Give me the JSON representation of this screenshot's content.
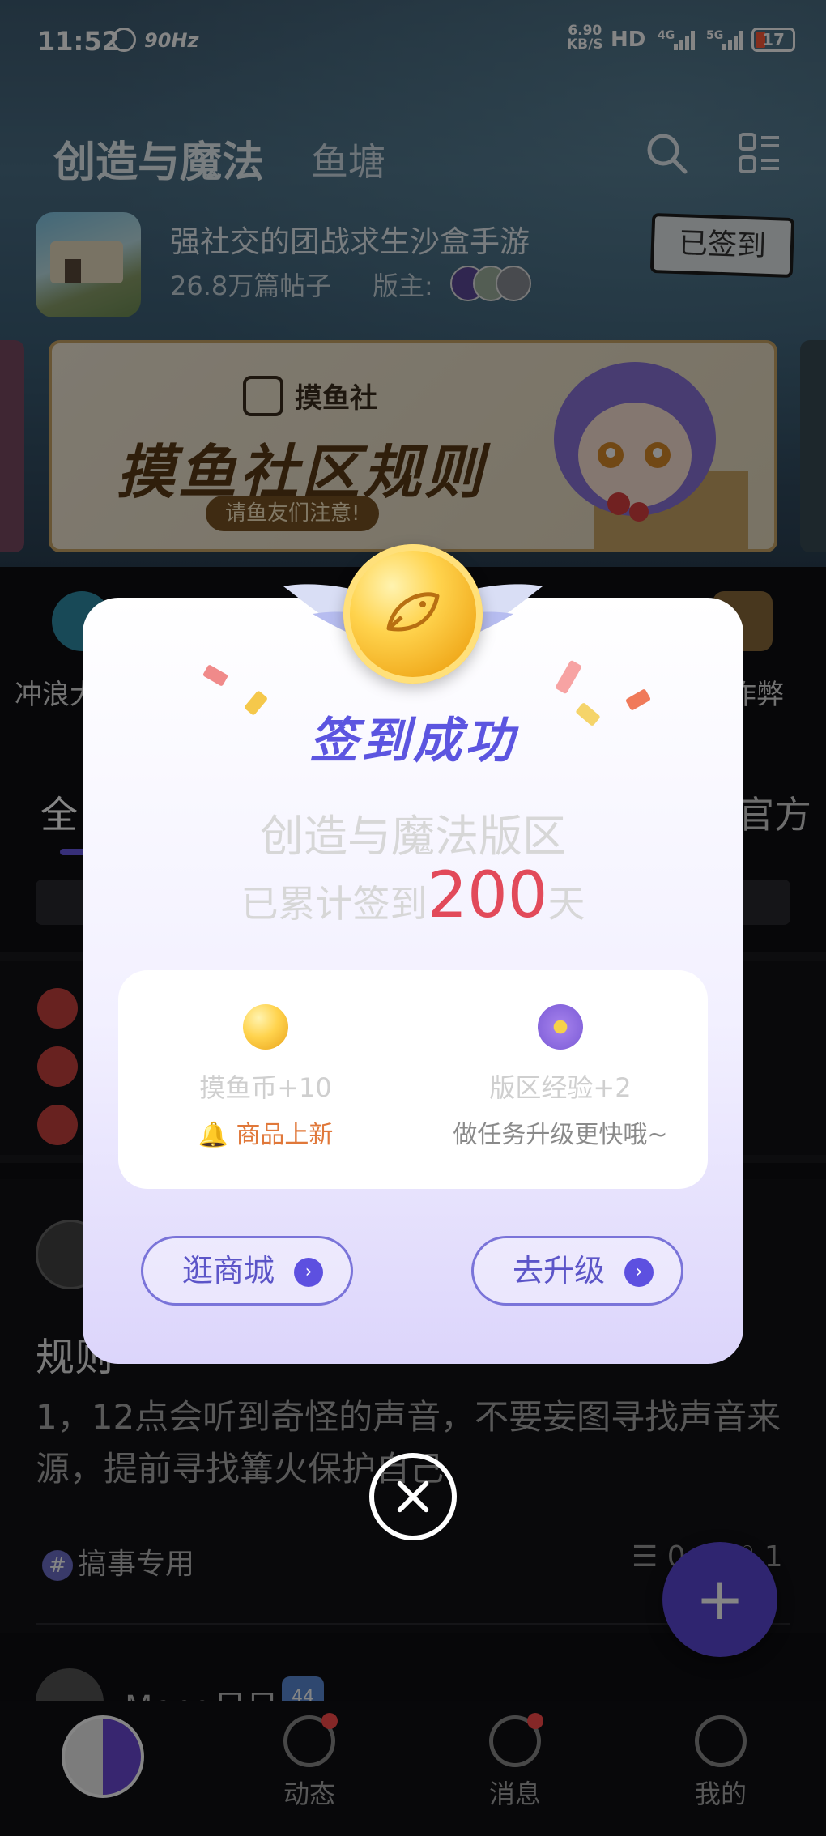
{
  "status_bar": {
    "time": "11:52",
    "refresh_rate": "90Hz",
    "net_speed": "6.90",
    "net_unit": "KB/S",
    "hd": "HD",
    "net1": "4G",
    "net2": "5G",
    "battery": "17"
  },
  "top_nav": {
    "title": "创造与魔法",
    "tab2": "鱼塘"
  },
  "forum": {
    "description": "强社交的团战求生沙盒手游",
    "posts": "26.8万篇帖子",
    "mods_label": "版主:",
    "signed_label": "已签到"
  },
  "banner": {
    "logo": "摸鱼社",
    "title": "摸鱼社区规则",
    "subtitle": "请鱼友们注意!"
  },
  "quick_links": [
    {
      "label": "冲浪大"
    },
    {
      "label": "作弊"
    }
  ],
  "section_tabs": [
    {
      "label": "全"
    },
    {
      "label": "官方"
    }
  ],
  "post": {
    "title": "规则",
    "body": "1，12点会听到奇怪的声音，不要妄图寻找声音来源，提前寻找篝火保护自己",
    "tag": "搞事专用",
    "comment_count": "0",
    "like_count": "1"
  },
  "next_post": {
    "author": "Meng呆呆",
    "badge": "44"
  },
  "bottom_nav": [
    {
      "label": "动态"
    },
    {
      "label": "消息"
    },
    {
      "label": "我的"
    }
  ],
  "modal": {
    "title": "签到成功",
    "forum_name": "创造与魔法版区",
    "days_prefix": "已累计签到",
    "days_count": "200",
    "days_suffix": "天",
    "reward_coin": "摸鱼币+10",
    "reward_coin_sub": "商品上新",
    "reward_exp": "版区经验+2",
    "reward_exp_sub": "做任务升级更快哦~",
    "btn_shop": "逛商城",
    "btn_upgrade": "去升级"
  },
  "colors": {
    "accent": "#5c55e0",
    "days_count": "#e24a5a",
    "coin_sub": "#e0783a",
    "fab": "#5a47d6"
  }
}
